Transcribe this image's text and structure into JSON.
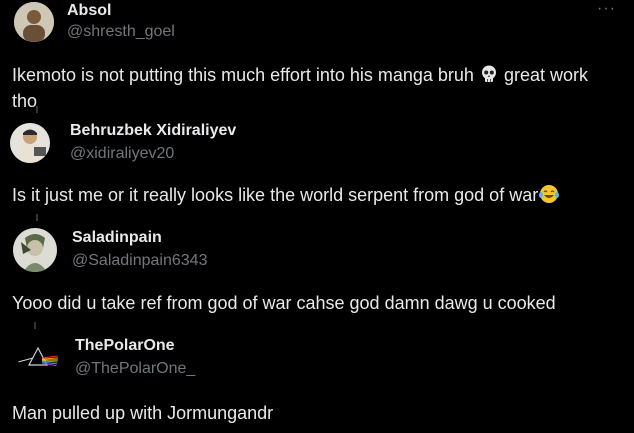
{
  "replies": [
    {
      "name": "Absol",
      "handle": "@shresth_goel",
      "text_before": "Ikemoto is not putting this much effort into his manga bruh",
      "emoji": "skull-emoji",
      "text_after": " great work tho"
    },
    {
      "name": "Behruzbek Xidiraliyev",
      "handle": "@xidiraliyev20",
      "text_before": "Is it just me or it really looks like the world serpent from god of war",
      "emoji": "joy-emoji",
      "text_after": ""
    },
    {
      "name": "Saladinpain",
      "handle": "@Saladinpain6343",
      "text_before": "Yooo did u take ref from god of war cahse god damn dawg u cooked",
      "text_after": ""
    },
    {
      "name": "ThePolarOne",
      "handle": "@ThePolarOne_",
      "text_before": "Man pulled up with Jormungandr",
      "text_after": ""
    }
  ],
  "more_label": "···",
  "colors": {
    "background": "#000000",
    "primary_text": "#e7e9ea",
    "secondary_text": "#71767b"
  }
}
